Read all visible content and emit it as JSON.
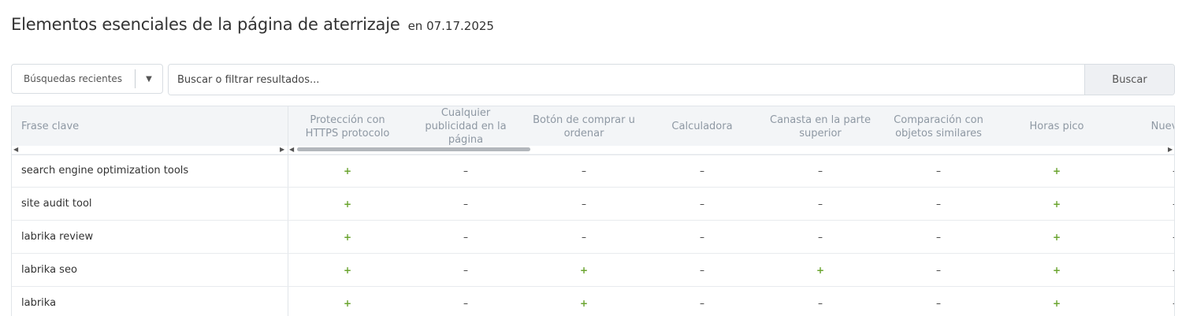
{
  "header": {
    "title": "Elementos esenciales de la página de aterrizaje",
    "date": "en 07.17.2025"
  },
  "toolbar": {
    "recent_label": "Búsquedas recientes",
    "search_placeholder": "Buscar o filtrar resultados...",
    "search_button": "Buscar"
  },
  "table": {
    "keyword_header": "Frase clave",
    "columns": [
      "Protección con HTTPS protocolo",
      "Cualquier publicidad en la página",
      "Botón de comprar u ordenar",
      "Calculadora",
      "Canasta en la parte superior",
      "Comparación con objetos similares",
      "Horas pico",
      "Nuevos p"
    ],
    "rows": [
      {
        "keyword": "search engine optimization tools",
        "cells": [
          "+",
          "–",
          "–",
          "–",
          "–",
          "–",
          "+",
          "–"
        ]
      },
      {
        "keyword": "site audit tool",
        "cells": [
          "+",
          "–",
          "–",
          "–",
          "–",
          "–",
          "+",
          "–"
        ]
      },
      {
        "keyword": "labrika review",
        "cells": [
          "+",
          "–",
          "–",
          "–",
          "–",
          "–",
          "+",
          "–"
        ]
      },
      {
        "keyword": "labrika seo",
        "cells": [
          "+",
          "–",
          "+",
          "–",
          "+",
          "–",
          "+",
          "–"
        ]
      },
      {
        "keyword": "labrika",
        "cells": [
          "+",
          "–",
          "+",
          "–",
          "–",
          "–",
          "+",
          "–"
        ]
      }
    ],
    "colors": {
      "positive": "#6aa42f",
      "header_text": "#8e98a3",
      "header_bg": "#f3f5f7"
    }
  }
}
